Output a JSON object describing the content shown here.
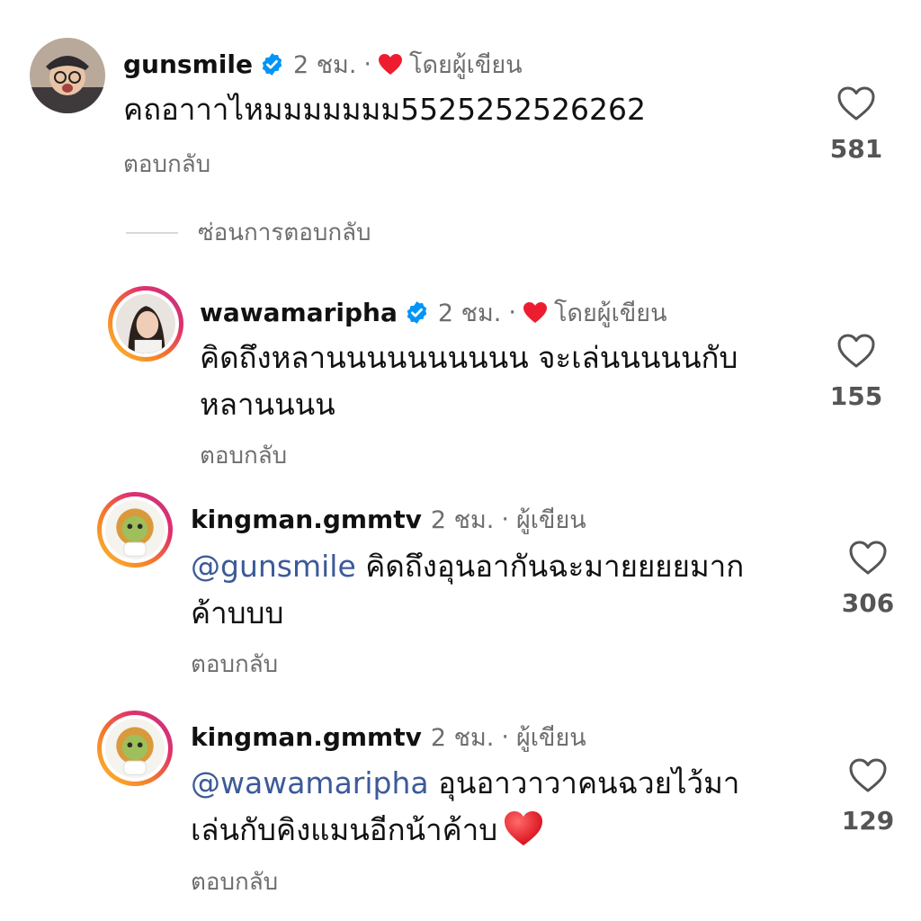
{
  "comments": [
    {
      "username": "gunsmile",
      "time": "2 ชม.",
      "dot": "·",
      "by_author": "โดยผู้เขียน",
      "text": "คถอาาาไหมมมมมมม5525252526262",
      "reply": "ตอบกลับ",
      "likes": "581"
    },
    {
      "username": "wawamaripha",
      "time": "2 ชม.",
      "dot": "·",
      "by_author": "โดยผู้เขียน",
      "text_line1": "คิดถึงหลานนนนนนนนนน จะเล่นนนนนกับ",
      "text_line2": "หลานนนน",
      "reply": "ตอบกลับ",
      "likes": "155"
    },
    {
      "username": "kingman.gmmtv",
      "time": "2 ชม.",
      "dot": "·",
      "by_author": "ผู้เขียน",
      "mention": "@gunsmile",
      "text_line1": " คิดถึงอุนอากันฉะมายยยยมาก",
      "text_line2": "ค้าบบบ",
      "reply": "ตอบกลับ",
      "likes": "306"
    },
    {
      "username": "kingman.gmmtv",
      "time": "2 ชม.",
      "dot": "·",
      "by_author": "ผู้เขียน",
      "mention": "@wawamaripha",
      "text_line1": " อุนอาวาวาคนฉวยไว้มา",
      "text_line2": "เล่นกับคิงแมนอีกน้าค้าบ",
      "reply": "ตอบกลับ",
      "likes": "129"
    }
  ],
  "hide_replies": "ซ่อนการตอบกลับ",
  "colors": {
    "verified": "#0095f6",
    "heart": "#ed1d2f",
    "mention": "#3d5a99",
    "secondary_text": "#6e6e6e"
  },
  "icons": [
    "verified-badge-icon",
    "red-heart-icon",
    "like-heart-outline-icon",
    "red-heart-emoji"
  ]
}
